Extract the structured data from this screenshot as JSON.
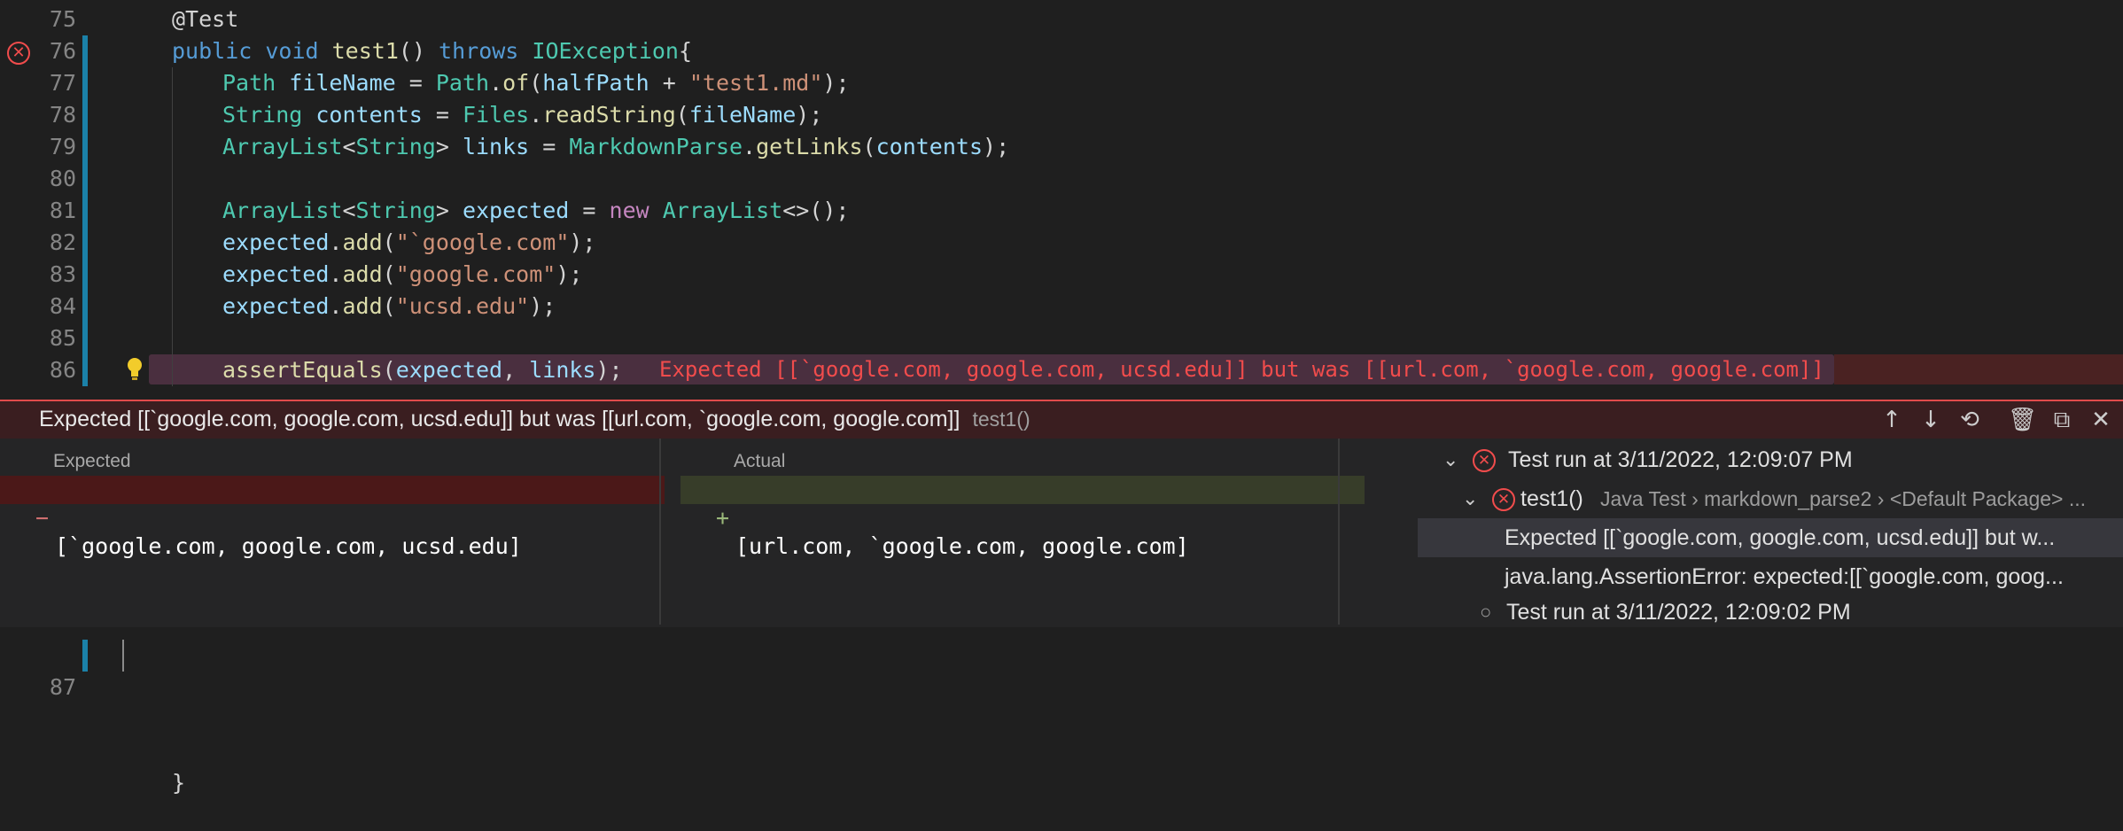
{
  "editor": {
    "lines": [
      {
        "n": "75",
        "tokens": [
          [
            "a",
            "@Test"
          ]
        ]
      },
      {
        "n": "76",
        "tokens": [
          [
            "k",
            "public "
          ],
          [
            "k",
            "void "
          ],
          [
            "f",
            "test1"
          ],
          [
            "o",
            "() "
          ],
          [
            "k",
            "throws "
          ],
          [
            "t",
            "IOException"
          ],
          [
            "o",
            "{"
          ]
        ]
      },
      {
        "n": "77",
        "tokens": [
          [
            "t",
            "Path "
          ],
          [
            "v",
            "fileName"
          ],
          [
            "o",
            " = "
          ],
          [
            "t",
            "Path"
          ],
          [
            "o",
            "."
          ],
          [
            "f",
            "of"
          ],
          [
            "o",
            "("
          ],
          [
            "v",
            "halfPath"
          ],
          [
            "o",
            " + "
          ],
          [
            "s",
            "\"test1.md\""
          ],
          [
            "o",
            ");"
          ]
        ]
      },
      {
        "n": "78",
        "tokens": [
          [
            "t",
            "String "
          ],
          [
            "v",
            "contents"
          ],
          [
            "o",
            " = "
          ],
          [
            "t",
            "Files"
          ],
          [
            "o",
            "."
          ],
          [
            "f",
            "readString"
          ],
          [
            "o",
            "("
          ],
          [
            "v",
            "fileName"
          ],
          [
            "o",
            ");"
          ]
        ]
      },
      {
        "n": "79",
        "tokens": [
          [
            "t",
            "ArrayList"
          ],
          [
            "o",
            "<"
          ],
          [
            "t",
            "String"
          ],
          [
            "o",
            "> "
          ],
          [
            "v",
            "links"
          ],
          [
            "o",
            " = "
          ],
          [
            "t",
            "MarkdownParse"
          ],
          [
            "o",
            "."
          ],
          [
            "f",
            "getLinks"
          ],
          [
            "o",
            "("
          ],
          [
            "v",
            "contents"
          ],
          [
            "o",
            ");"
          ]
        ]
      },
      {
        "n": "80",
        "tokens": []
      },
      {
        "n": "81",
        "tokens": [
          [
            "t",
            "ArrayList"
          ],
          [
            "o",
            "<"
          ],
          [
            "t",
            "String"
          ],
          [
            "o",
            "> "
          ],
          [
            "v",
            "expected"
          ],
          [
            "o",
            " = "
          ],
          [
            "kw2",
            "new "
          ],
          [
            "t",
            "ArrayList"
          ],
          [
            "o",
            "<>();"
          ]
        ]
      },
      {
        "n": "82",
        "tokens": [
          [
            "v",
            "expected"
          ],
          [
            "o",
            "."
          ],
          [
            "f",
            "add"
          ],
          [
            "o",
            "("
          ],
          [
            "s",
            "\"`google.com\""
          ],
          [
            "o",
            ");"
          ]
        ]
      },
      {
        "n": "83",
        "tokens": [
          [
            "v",
            "expected"
          ],
          [
            "o",
            "."
          ],
          [
            "f",
            "add"
          ],
          [
            "o",
            "("
          ],
          [
            "s",
            "\"google.com\""
          ],
          [
            "o",
            ");"
          ]
        ]
      },
      {
        "n": "84",
        "tokens": [
          [
            "v",
            "expected"
          ],
          [
            "o",
            "."
          ],
          [
            "f",
            "add"
          ],
          [
            "o",
            "("
          ],
          [
            "s",
            "\"ucsd.edu\""
          ],
          [
            "o",
            ");"
          ]
        ]
      },
      {
        "n": "85",
        "tokens": []
      },
      {
        "n": "86",
        "tokens": [
          [
            "f",
            "assertEquals"
          ],
          [
            "o",
            "("
          ],
          [
            "v",
            "expected"
          ],
          [
            "o",
            ", "
          ],
          [
            "v",
            "links"
          ],
          [
            "o",
            ");"
          ]
        ]
      }
    ],
    "inline_error": "Expected [[`google.com, google.com, ucsd.edu]] but was [[url.com, `google.com, google.com]]",
    "line87": {
      "n": "87",
      "text": "}"
    }
  },
  "peek": {
    "message": "Expected [[`google.com, google.com, ucsd.edu]] but was [[url.com, `google.com, google.com]]",
    "test_name": "test1()",
    "toolbar": [
      "arrow-up-icon",
      "arrow-down-icon",
      "history-icon",
      "trash-icon",
      "open-external-icon",
      "close-icon"
    ],
    "expected_label": "Expected",
    "actual_label": "Actual",
    "expected_sign": "−",
    "expected_value": "[`google.com, google.com, ucsd.edu]",
    "actual_sign": "+",
    "actual_value": "[url.com, `google.com, google.com]"
  },
  "test_tree": [
    {
      "label": "Test run at 3/11/2022, 12:09:07 PM"
    },
    {
      "label": "test1()",
      "detail": "Java Test › markdown_parse2 › <Default Package> ..."
    },
    {
      "label": "Expected [[`google.com, google.com, ucsd.edu]] but w..."
    },
    {
      "label": "java.lang.AssertionError: expected:[[`google.com, goog..."
    },
    {
      "label": "Test run at 3/11/2022, 12:09:02 PM"
    }
  ],
  "colors": {
    "error": "#f14c4c",
    "gutter_modified": "#1b81a8",
    "expected_bg": "#4b1818",
    "actual_bg": "#373d29"
  }
}
